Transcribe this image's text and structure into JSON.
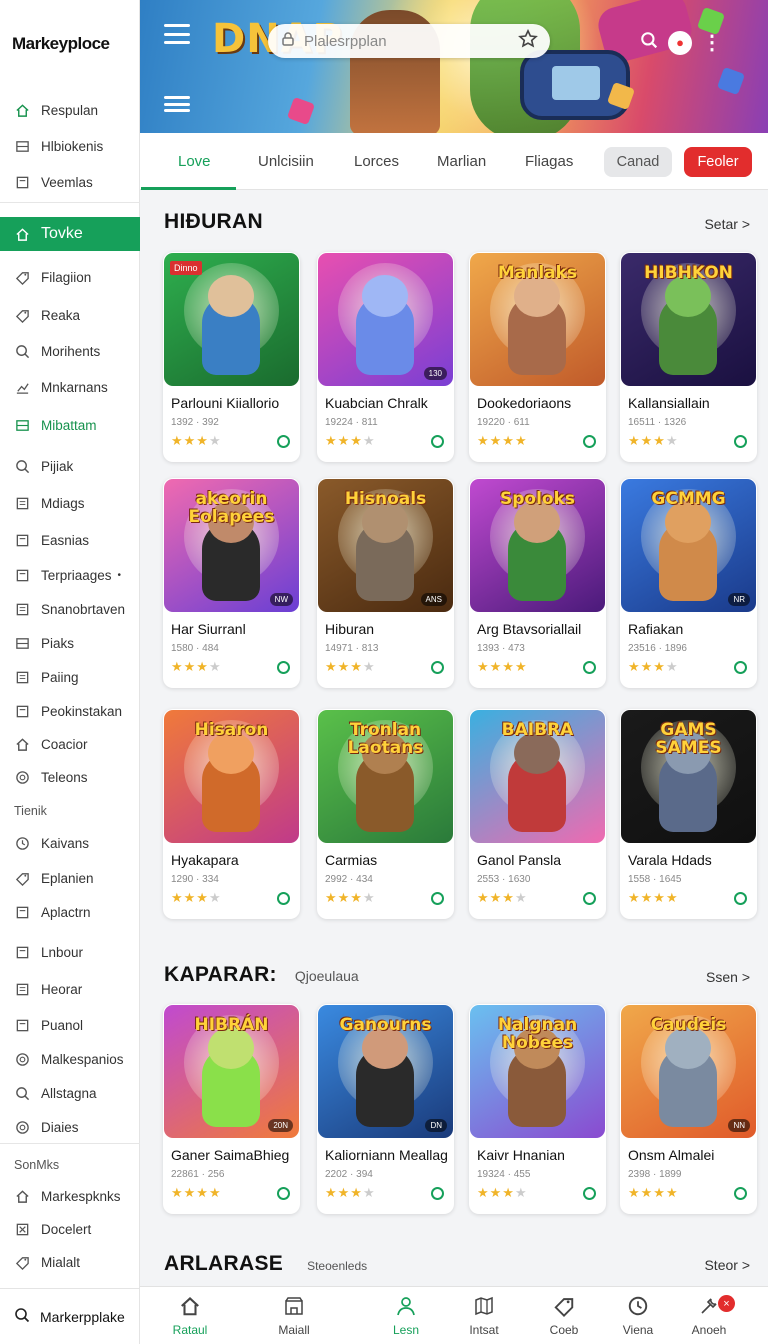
{
  "app": {
    "logo": "Markeyploce"
  },
  "sidebar": {
    "items": [
      {
        "label": "Respulan",
        "icon": "home-icon",
        "style": "green-icon"
      },
      {
        "label": "Hlbiokenis",
        "icon": "grid-icon"
      },
      {
        "label": "Veemlas",
        "icon": "box-icon"
      },
      {
        "label": "Tovke",
        "icon": "home-icon",
        "style": "active"
      },
      {
        "label": "Filagiion",
        "icon": "tag-icon"
      },
      {
        "label": "Reaka",
        "icon": "tag-icon"
      },
      {
        "label": "Morihents",
        "icon": "search-icon"
      },
      {
        "label": "Mnkarnans",
        "icon": "chart-icon"
      },
      {
        "label": "Mibattam",
        "icon": "grid-icon",
        "style": "green"
      },
      {
        "label": "Pijiak",
        "icon": "search-icon"
      },
      {
        "label": "Mdiags",
        "icon": "list-icon"
      },
      {
        "label": "Easnias",
        "icon": "box-icon"
      },
      {
        "label": "Terpriaages",
        "icon": "box-icon",
        "dot": "•"
      },
      {
        "label": "Snanobrtaven",
        "icon": "list-icon"
      },
      {
        "label": "Piaks",
        "icon": "grid-icon"
      },
      {
        "label": "Paiing",
        "icon": "list-icon"
      },
      {
        "label": "Peokinstakan",
        "icon": "box-icon"
      },
      {
        "label": "Coacior",
        "icon": "home-icon"
      },
      {
        "label": "Teleons",
        "icon": "circle-icon"
      }
    ],
    "section2_label": "Tienik",
    "items2": [
      {
        "label": "Kaivans",
        "icon": "clock-icon"
      },
      {
        "label": "Eplanien",
        "icon": "tag-icon"
      },
      {
        "label": "Aplactrn",
        "icon": "box-icon"
      },
      {
        "label": "Lnbour",
        "icon": "box-icon"
      },
      {
        "label": "Heorar",
        "icon": "list-icon"
      },
      {
        "label": "Puanol",
        "icon": "box-icon"
      },
      {
        "label": "Malkespanios",
        "icon": "circle-icon"
      },
      {
        "label": "Allstagna",
        "icon": "search-icon"
      },
      {
        "label": "Diaies",
        "icon": "circle-icon"
      }
    ],
    "section3_label": "SonMks",
    "items3": [
      {
        "label": "Markespknks",
        "icon": "home-icon"
      },
      {
        "label": "Docelert",
        "icon": "close-icon"
      },
      {
        "label": "Mialalt",
        "icon": "tag-icon"
      }
    ],
    "footer": "Markerpplake"
  },
  "header": {
    "banner_title": "DNAP",
    "search_placeholder": "Plalesrpplan"
  },
  "tabs": [
    "Love",
    "Unlcisiin",
    "Lorces",
    "Marlian",
    "Fliagas"
  ],
  "pills": {
    "cancel": "Canad",
    "feature": "Feoler"
  },
  "sections": [
    {
      "title": "HIĐURAN",
      "subtitle": "",
      "see_all": "Setar >",
      "cards": [
        {
          "name": "Parlouni Kiiallorio",
          "meta": "1392 · 392",
          "rating": 3,
          "title": "",
          "tag": "Dinno",
          "badge": "",
          "colors": [
            "#2eae4e",
            "#1a6b2e",
            "#3a7fc4",
            "#e0c09a"
          ]
        },
        {
          "name": "Kuabcian Chralk",
          "meta": "19224 · 811",
          "rating": 3,
          "title": "",
          "tag": "",
          "badge": "130",
          "colors": [
            "#e84fb0",
            "#7a3fd4",
            "#6a8be8",
            "#9fb7f5"
          ]
        },
        {
          "name": "Dookedoriaons",
          "meta": "19220 · 611",
          "rating": 4,
          "title": "Manlaks",
          "tag": "",
          "badge": "",
          "colors": [
            "#f0a84a",
            "#c05a2a",
            "#a86a4a",
            "#e0b08a"
          ]
        },
        {
          "name": "Kallansiallain",
          "meta": "16511 · 1326",
          "rating": 3,
          "title": "HIBHKON",
          "tag": "",
          "badge": "",
          "colors": [
            "#3a2a6a",
            "#1a1040",
            "#4a8a3a",
            "#7ac05a"
          ]
        },
        {
          "name": "Har Siurranl",
          "meta": "1580 · 484",
          "rating": 3,
          "title": "akeorin Eolapees",
          "tag": "",
          "badge": "NW",
          "colors": [
            "#f06ab0",
            "#6a3fd4",
            "#2a2a2a",
            "#c08a6a"
          ]
        },
        {
          "name": "Hiburan",
          "meta": "14971 · 813",
          "rating": 3,
          "title": "Hisnoals",
          "tag": "",
          "badge": "ANS",
          "colors": [
            "#8a5a2a",
            "#4a2a10",
            "#7a6a5a",
            "#b09070"
          ]
        },
        {
          "name": "Arg Btavsoriallail",
          "meta": "1393 · 473",
          "rating": 4,
          "title": "Spoloks",
          "tag": "",
          "badge": "",
          "colors": [
            "#c04ad0",
            "#4a1a7a",
            "#3a8a3a",
            "#d0a07a"
          ]
        },
        {
          "name": "Rafiakan",
          "meta": "23516 · 1896",
          "rating": 3,
          "title": "GCMMG",
          "tag": "",
          "badge": "NR",
          "colors": [
            "#3a7ae0",
            "#1a3a8a",
            "#d08a4a",
            "#e0a060"
          ]
        },
        {
          "name": "Hyakapara",
          "meta": "1290 · 334",
          "rating": 3,
          "title": "Hisaron",
          "tag": "",
          "badge": "",
          "colors": [
            "#f07a3a",
            "#c03a8a",
            "#d06a2a",
            "#f0a060"
          ]
        },
        {
          "name": "Carmias",
          "meta": "2992 · 434",
          "rating": 3,
          "title": "Tronlan Laotans",
          "tag": "",
          "badge": "",
          "colors": [
            "#5ac04a",
            "#2a7a3a",
            "#8a5a2a",
            "#b08050"
          ]
        },
        {
          "name": "Ganol Pansla",
          "meta": "2553 · 1630",
          "rating": 3,
          "title": "BAIBRA",
          "tag": "",
          "badge": "",
          "colors": [
            "#3ab0e0",
            "#f06ab0",
            "#c03a3a",
            "#8a6a5a"
          ]
        },
        {
          "name": "Varala Hdads",
          "meta": "1558 · 1645",
          "rating": 4,
          "title": "GAMS SAMES",
          "tag": "",
          "badge": "",
          "colors": [
            "#1a1a1a",
            "#101010",
            "#5a6a8a",
            "#8a9ab0"
          ]
        }
      ]
    },
    {
      "title": "KAPARAR:",
      "subtitle": "Qjoeulaua",
      "see_all": "Ssen >",
      "cards": [
        {
          "name": "Ganer SaimaBhieg",
          "meta": "22861 · 256",
          "rating": 4,
          "title": "HIBRÁN",
          "tag": "",
          "badge": "20N",
          "colors": [
            "#c04ad0",
            "#f07a3a",
            "#8ae04a",
            "#c0e070"
          ]
        },
        {
          "name": "Kaliorniann Meallag",
          "meta": "2202 · 394",
          "rating": 3,
          "title": "Ganourns",
          "tag": "",
          "badge": "DN",
          "colors": [
            "#3a8ae0",
            "#1a3a7a",
            "#2a2a2a",
            "#d09a7a"
          ]
        },
        {
          "name": "Kaivr Hnanian",
          "meta": "19324 · 455",
          "rating": 3,
          "title": "Nalgnan Nobees",
          "tag": "",
          "badge": "",
          "colors": [
            "#6ac0f0",
            "#8a4ad0",
            "#8a5a3a",
            "#c08a5a"
          ]
        },
        {
          "name": "Onsm Almalei",
          "meta": "2398 · 1899",
          "rating": 4,
          "title": "Caudeis",
          "tag": "",
          "badge": "NN",
          "colors": [
            "#f0a84a",
            "#e05a2a",
            "#7a8aa0",
            "#a0b0c0"
          ]
        }
      ]
    },
    {
      "title": "ARLARASE",
      "subtitle": "Steoenleds",
      "see_all": "Steor >"
    }
  ],
  "bottom_nav": [
    {
      "label": "Rataul",
      "icon": "home-icon",
      "active": false,
      "green_label": true
    },
    {
      "label": "Maiall",
      "icon": "store-icon",
      "active": false
    },
    {
      "label": "Lesn",
      "icon": "user-icon",
      "active": true
    },
    {
      "label": "Intsat",
      "icon": "map-icon",
      "active": false
    },
    {
      "label": "Coeb",
      "icon": "tag-icon",
      "active": false
    },
    {
      "label": "Viena",
      "icon": "clock-icon",
      "active": false
    },
    {
      "label": "Anoeh",
      "icon": "tools-icon",
      "active": false,
      "badge": "×"
    }
  ],
  "colors": {
    "accent": "#16a05a",
    "danger": "#e22d2d"
  }
}
